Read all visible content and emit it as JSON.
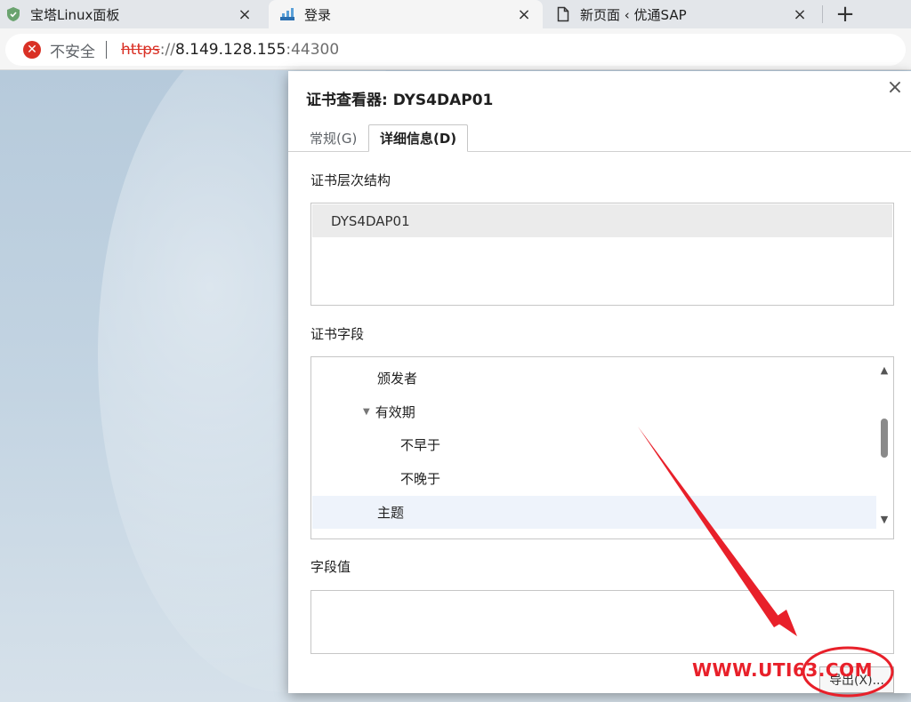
{
  "browser": {
    "tabs": [
      {
        "title": "宝塔Linux面板",
        "icon": "shield-icon",
        "active": false
      },
      {
        "title": "登录",
        "icon": "site-chart-icon",
        "active": true
      },
      {
        "title": "新页面 ‹ 优通SAP",
        "icon": "page-icon",
        "active": false
      }
    ],
    "close_glyph": "×",
    "newtab_glyph": "+"
  },
  "address_bar": {
    "security_icon": "error-circle-icon",
    "security_text": "不安全",
    "url_scheme": "https",
    "url_separator": "://",
    "url_host": "8.149.128.155",
    "url_port": ":44300"
  },
  "dialog": {
    "title": "证书查看器: DYS4DAP01",
    "close_glyph": "×",
    "tabs": [
      {
        "label": "常规(G)",
        "active": false
      },
      {
        "label": "详细信息(D)",
        "active": true
      }
    ],
    "hierarchy_label": "证书层次结构",
    "hierarchy_items": [
      "DYS4DAP01"
    ],
    "fields_label": "证书字段",
    "fields": [
      {
        "label": "颁发者",
        "level": 1,
        "expanded": null,
        "selected": false
      },
      {
        "label": "有效期",
        "level": 1,
        "expanded": true,
        "selected": false
      },
      {
        "label": "不早于",
        "level": 2,
        "expanded": null,
        "selected": false
      },
      {
        "label": "不晚于",
        "level": 2,
        "expanded": null,
        "selected": false
      },
      {
        "label": "主题",
        "level": 1,
        "expanded": null,
        "selected": true
      }
    ],
    "value_label": "字段值",
    "value_text": "",
    "export_label": "导出(X)..."
  },
  "annotation": {
    "watermark": "WWW.UTI63.COM",
    "color": "#e8202a"
  },
  "colors": {
    "tabstrip": "#e3e6ea",
    "active_tab": "#f5f5f5",
    "error_red": "#d93025",
    "selection": "#eef3fb"
  }
}
